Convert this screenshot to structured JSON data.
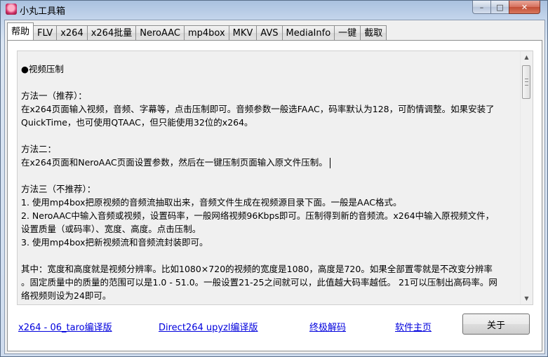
{
  "window": {
    "title": "小丸工具箱",
    "minimize_glyph": "–",
    "maximize_glyph": "□",
    "close_glyph": "✕"
  },
  "tabs": [
    {
      "label": "帮助",
      "active": true
    },
    {
      "label": "FLV"
    },
    {
      "label": "x264"
    },
    {
      "label": "x264批量"
    },
    {
      "label": "NeroAAC"
    },
    {
      "label": "mp4box"
    },
    {
      "label": "MKV"
    },
    {
      "label": "AVS"
    },
    {
      "label": "MediaInfo"
    },
    {
      "label": "一键"
    },
    {
      "label": "截取"
    }
  ],
  "help": {
    "lines": [
      "●视频压制",
      "",
      "方法一（推荐）：",
      "在x264页面输入视频，音频、字幕等，点击压制即可。音频参数一般选FAAC，码率默认为128，可酌情调整。如果安装了",
      "QuickTime，也可使用QTAAC，但只能使用32位的x264。",
      "",
      "方法二：",
      "在x264页面和NeroAAC页面设置参数，然后在一键压制页面输入原文件压制。",
      "",
      "方法三（不推荐）：",
      "1. 使用mp4box把原视频的音频流抽取出来，音频文件生成在视频源目录下面。一般是AAC格式。",
      "2. NeroAAC中输入音频或视频，设置码率，一般网络视频96Kbps即可。压制得到新的音频流。x264中输入原视频文件，",
      "设置质量（或码率）、宽度、高度。点击压制。",
      "3. 使用mp4box把新视频流和音频流封装即可。",
      "",
      "其中：宽度和高度就是视频分辨率。比如1080×720的视频的宽度是1080，高度是720。如果全部置零就是不改变分辨率",
      "。固定质量中的质量的范围可以是1.0 - 51.0。一般设置21-25之间就可以，此值越大码率越低。 21可以压制出高码率。网",
      "络视频则设为24即可。"
    ]
  },
  "footer": {
    "links": [
      "x264 - 06_taro编译版",
      "Direct264 upyzl编译版",
      "终极解码",
      "软件主页"
    ],
    "about_label": "关于"
  },
  "scrollbar": {
    "up_glyph": "▲",
    "down_glyph": "▼"
  }
}
